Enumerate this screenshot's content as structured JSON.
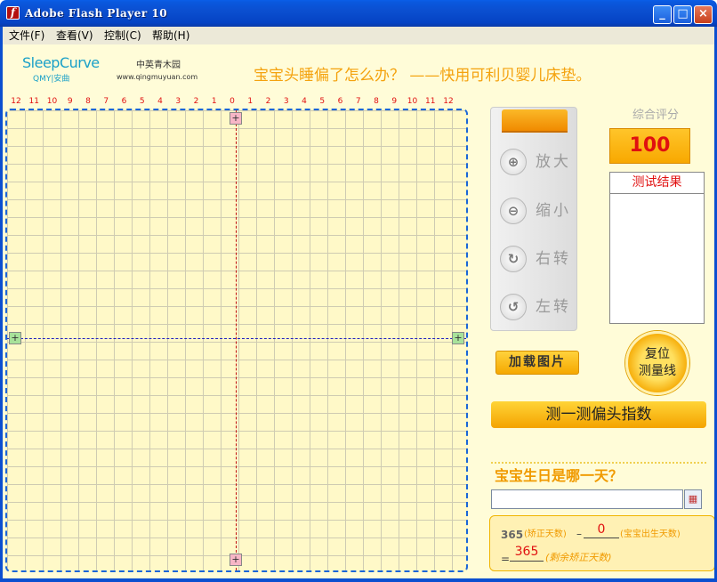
{
  "window": {
    "title": "Adobe Flash Player 10",
    "app_icon": "f",
    "controls": {
      "minimize": "_",
      "maximize": "□",
      "close": "×"
    }
  },
  "menu": [
    "文件(F)",
    "查看(V)",
    "控制(C)",
    "帮助(H)"
  ],
  "header": {
    "logo_text": "SleepCurve",
    "logo_sub": "QMY|安曲",
    "brand_cn": "中英青木园",
    "brand_url": "www.qingmuyuan.com",
    "slogan": "宝宝头睡偏了怎么办？ ——快用可利贝婴儿床垫。"
  },
  "ruler": [
    "12",
    "11",
    "10",
    "9",
    "8",
    "7",
    "6",
    "5",
    "4",
    "3",
    "2",
    "1",
    "0",
    "1",
    "2",
    "3",
    "4",
    "5",
    "6",
    "7",
    "8",
    "9",
    "10",
    "11",
    "12"
  ],
  "handles": {
    "top": "+",
    "bottom": "+",
    "left": "+",
    "right": "+"
  },
  "tools": {
    "zoom_in": "放大",
    "zoom_out": "缩小",
    "rotate_right": "右转",
    "rotate_left": "左转"
  },
  "score": {
    "label": "综合评分",
    "value": "100"
  },
  "result": {
    "title": "测试结果"
  },
  "buttons": {
    "load_image": "加载图片",
    "reset_line1": "复位",
    "reset_line2": "测量线",
    "measure": "测一测偏头指数"
  },
  "birthday": {
    "label": "宝宝生日是哪一天？",
    "date_value": "",
    "calendar_icon": "▦"
  },
  "calc": {
    "corrected_days": "365",
    "corrected_days_note": "(矫正天数)",
    "minus": "–",
    "birth_days": "0",
    "birth_days_note": "(宝宝出生天数)",
    "equals": "=",
    "remaining": "365",
    "remaining_note": "(剩余矫正天数)"
  },
  "colors": {
    "titlebar": "#0b4fd0",
    "content_bg": "#fffcd8",
    "accent_orange": "#f5a800",
    "ruler_red": "#e01010",
    "grid_border": "#1a66d8"
  }
}
